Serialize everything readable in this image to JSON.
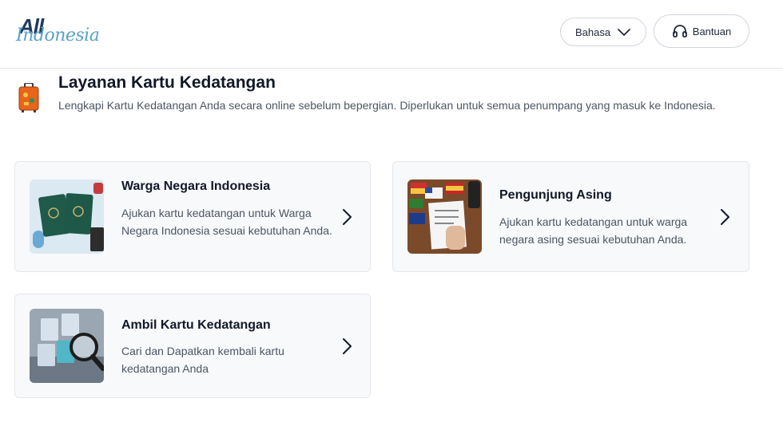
{
  "header": {
    "logo_top": "All",
    "logo_bottom": "Indonesia",
    "language_label": "Bahasa",
    "help_label": "Bantuan"
  },
  "intro": {
    "title": "Layanan Kartu Kedatangan",
    "subtitle": "Lengkapi Kartu Kedatangan Anda secara online sebelum bepergian. Diperlukan untuk semua penumpang yang masuk ke Indonesia."
  },
  "cards": [
    {
      "title": "Warga Negara Indonesia",
      "description": "Ajukan kartu kedatangan untuk Warga Negara Indonesia sesuai kebutuhan Anda."
    },
    {
      "title": "Pengunjung Asing",
      "description": "Ajukan kartu kedatangan untuk warga negara asing sesuai kebutuhan Anda."
    },
    {
      "title": "Ambil Kartu Kedatangan",
      "description": "Cari dan Dapatkan kembali kartu kedatangan Anda"
    }
  ],
  "icons": {
    "language_chevron": "chevron-down-icon",
    "help": "headset-icon",
    "intro": "luggage-icon",
    "card_arrow": "chevron-right-icon"
  }
}
